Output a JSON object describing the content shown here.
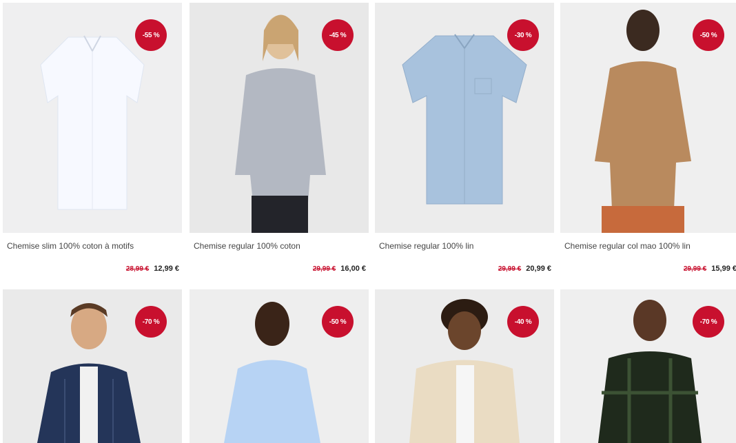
{
  "products": [
    {
      "title": "Chemise slim 100% coton à motifs",
      "badge": "-55 %",
      "old_price": "28,99 €",
      "new_price": "12,99 €"
    },
    {
      "title": "Chemise regular 100% coton",
      "badge": "-45 %",
      "old_price": "29,99 €",
      "new_price": "16,00 €"
    },
    {
      "title": "Chemise regular 100% lin",
      "badge": "-30 %",
      "old_price": "29,99 €",
      "new_price": "20,99 €"
    },
    {
      "title": "Chemise regular col mao 100% lin",
      "badge": "-50 %",
      "old_price": "29,99 €",
      "new_price": "15,99 €"
    },
    {
      "title": "",
      "badge": "-70 %",
      "old_price": "",
      "new_price": ""
    },
    {
      "title": "",
      "badge": "-50 %",
      "old_price": "",
      "new_price": ""
    },
    {
      "title": "",
      "badge": "-40 %",
      "old_price": "",
      "new_price": ""
    },
    {
      "title": "",
      "badge": "-70 %",
      "old_price": "",
      "new_price": ""
    }
  ],
  "colors": {
    "badge": "#c8102e",
    "old_price": "#c8102e",
    "image_bg": "#e9e9ea"
  }
}
